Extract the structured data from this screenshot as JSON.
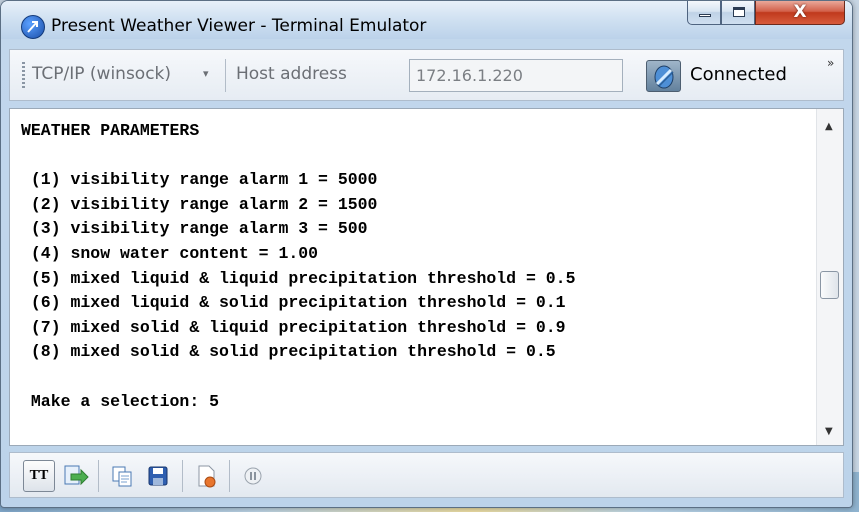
{
  "window": {
    "title": "Present Weather Viewer - Terminal Emulator",
    "close_glyph": "X"
  },
  "toolbar": {
    "protocol": "TCP/IP (winsock)",
    "protocol_arrow": "▾",
    "host_label": "Host address",
    "host_value": "172.16.1.220",
    "status": "Connected",
    "overflow": "»"
  },
  "terminal": {
    "lines": [
      "WEATHER PARAMETERS",
      "",
      " (1) visibility range alarm 1 = 5000",
      " (2) visibility range alarm 2 = 1500",
      " (3) visibility range alarm 3 = 500",
      " (4) snow water content = 1.00",
      " (5) mixed liquid & liquid precipitation threshold = 0.5",
      " (6) mixed liquid & solid precipitation threshold = 0.1",
      " (7) mixed solid & liquid precipitation threshold = 0.9",
      " (8) mixed solid & solid precipitation threshold = 0.5",
      "",
      " Make a selection: 5"
    ]
  },
  "scrollbar": {
    "up": "▲",
    "down": "▼"
  },
  "bottombar": {
    "tt_label": "TT",
    "icons": [
      "tt-toggle-icon",
      "send-file-icon",
      "copy-icon",
      "save-icon",
      "log-icon",
      "pause-icon"
    ]
  }
}
